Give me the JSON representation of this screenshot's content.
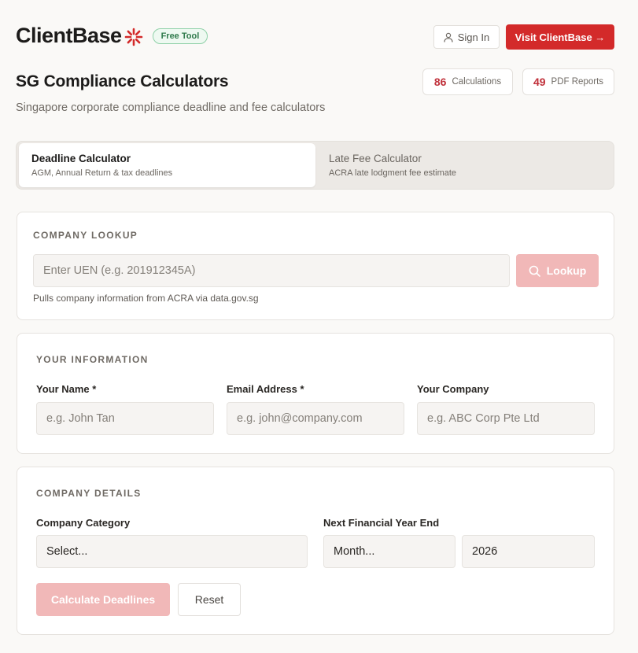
{
  "header": {
    "logo_text": "ClientBase",
    "badge": "Free Tool",
    "signin_label": "Sign In",
    "visit_label": "Visit ClientBase →"
  },
  "page": {
    "title": "SG Compliance Calculators",
    "subtitle": "Singapore corporate compliance deadline and fee calculators"
  },
  "stats": [
    {
      "value": "86",
      "label": "Calculations"
    },
    {
      "value": "49",
      "label": "PDF Reports"
    }
  ],
  "tabs": [
    {
      "title": "Deadline Calculator",
      "subtitle": "AGM, Annual Return & tax deadlines",
      "active": true
    },
    {
      "title": "Late Fee Calculator",
      "subtitle": "ACRA late lodgment fee estimate",
      "active": false
    }
  ],
  "company_lookup": {
    "section": "COMPANY LOOKUP",
    "uen_placeholder": "Enter UEN (e.g. 201912345A)",
    "lookup_label": "Lookup",
    "hint": "Pulls company information from ACRA via data.gov.sg"
  },
  "your_info": {
    "section": "YOUR INFORMATION",
    "name_label": "Your Name *",
    "name_placeholder": "e.g. John Tan",
    "email_label": "Email Address *",
    "email_placeholder": "e.g. john@company.com",
    "company_label": "Your Company",
    "company_placeholder": "e.g. ABC Corp Pte Ltd"
  },
  "company_details": {
    "section": "COMPANY DETAILS",
    "category_label": "Company Category",
    "category_value": "Select...",
    "fye_label": "Next Financial Year End",
    "month_value": "Month...",
    "year_value": "2026",
    "calculate_label": "Calculate Deadlines",
    "reset_label": "Reset"
  },
  "colors": {
    "brand_red": "#d32a2a",
    "disabled_red": "#f1b8b8",
    "badge_green": "#2f7a4b"
  }
}
